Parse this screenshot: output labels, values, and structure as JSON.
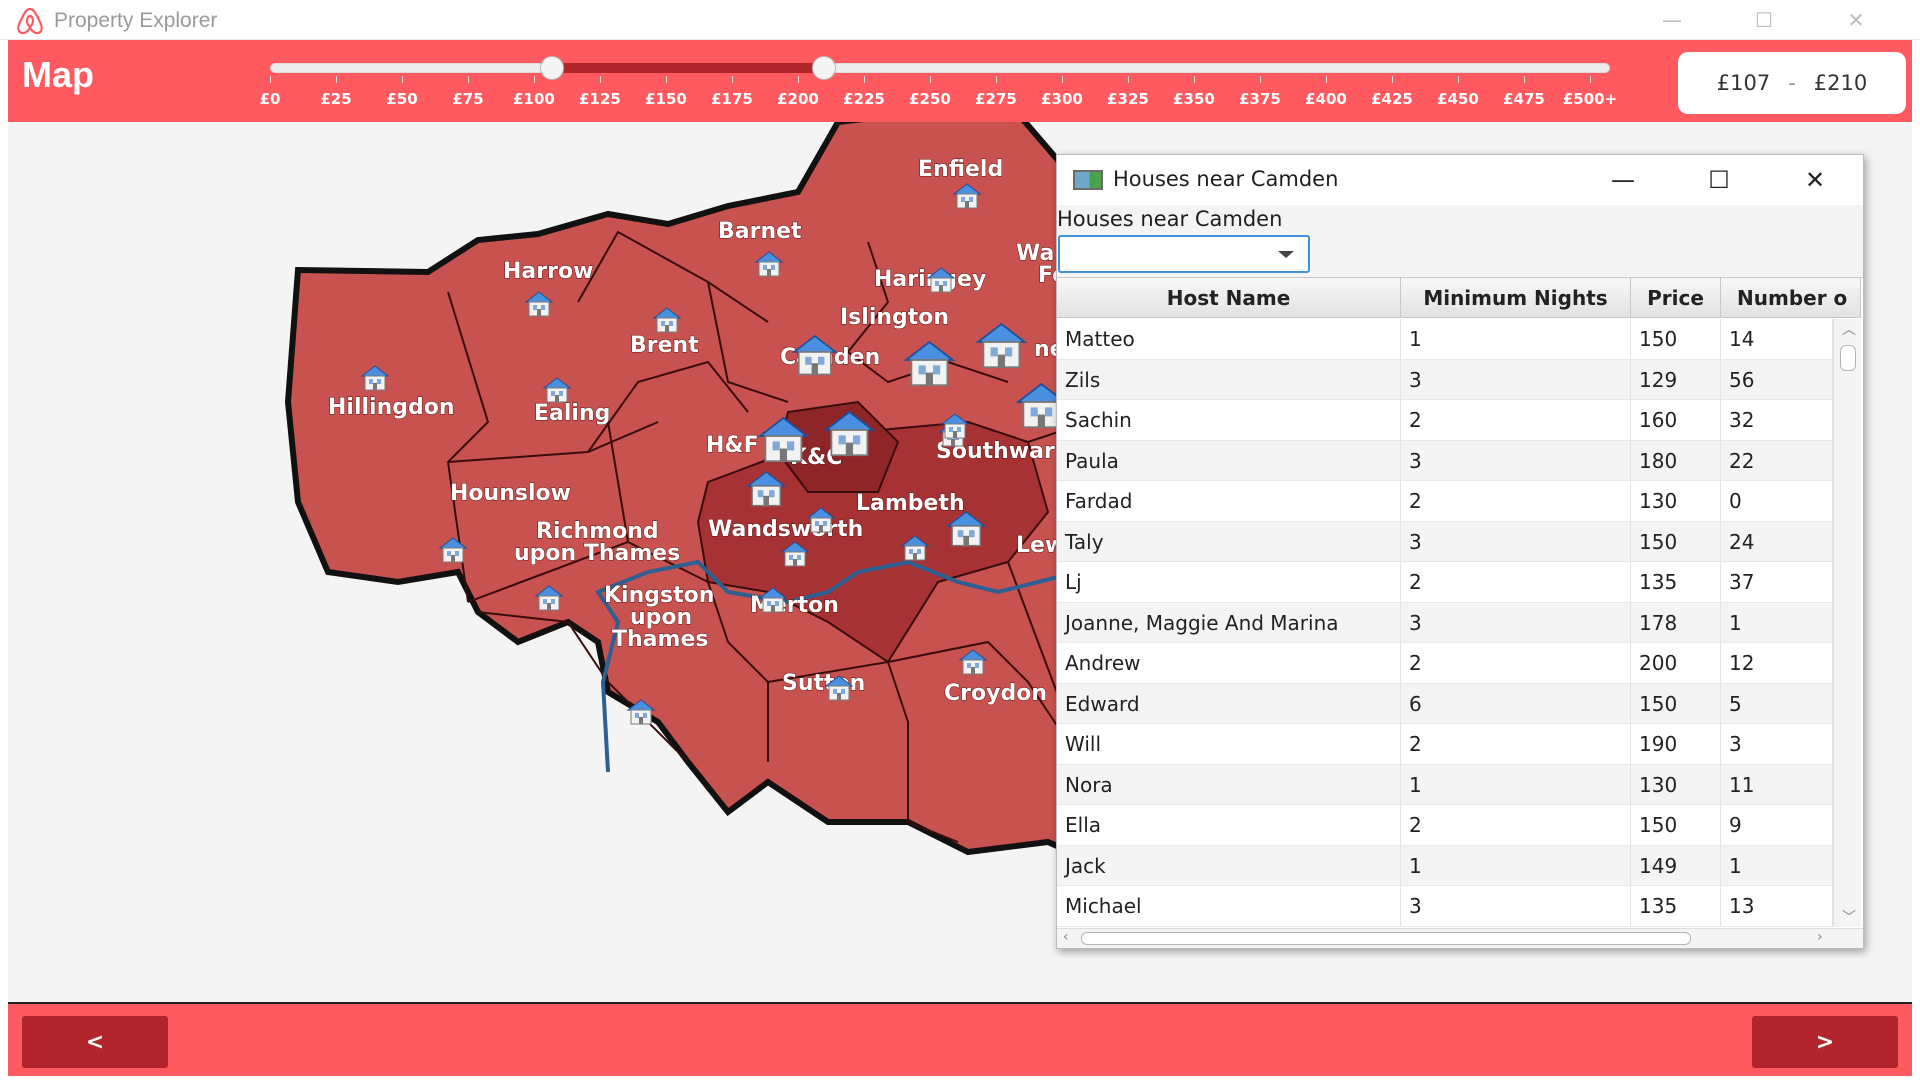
{
  "app": {
    "title": "Property Explorer",
    "window_controls": {
      "minimize": "—",
      "maximize": "☐",
      "close": "✕"
    }
  },
  "header": {
    "title": "Map",
    "slider": {
      "ticks": [
        "£0",
        "£25",
        "£50",
        "£75",
        "£100",
        "£125",
        "£150",
        "£175",
        "£200",
        "£225",
        "£250",
        "£275",
        "£300",
        "£325",
        "£350",
        "£375",
        "£400",
        "£425",
        "£450",
        "£475",
        "£500+"
      ],
      "min": 0,
      "max": 500,
      "low_value": 107,
      "high_value": 210
    },
    "price_min": "£107",
    "price_separator": "-",
    "price_max": "£210"
  },
  "map": {
    "boroughs": [
      "Enfield",
      "Barnet",
      "Harrow",
      "Haringey",
      "Islington",
      "Brent",
      "Camden",
      "Hillingdon",
      "Ealing",
      "H&F",
      "K&C",
      "Southwark",
      "Hounslow",
      "Lambeth",
      "Richmond",
      "upon Thames",
      "Wandsworth",
      "Kingston",
      "upon",
      "Thames",
      "Merton",
      "Sutton",
      "Croydon",
      "Lew",
      "Wa",
      "Fo",
      "ne"
    ],
    "house_icon": "house-icon"
  },
  "popup": {
    "title": "Houses near Camden",
    "label": "Houses near Camden",
    "combo_value": "",
    "window_controls": {
      "minimize": "—",
      "maximize": "☐",
      "close": "✕"
    },
    "table": {
      "columns": [
        "Host Name",
        "Minimum Nights",
        "Price",
        "Number o"
      ],
      "rows": [
        [
          "Matteo",
          "1",
          "150",
          "14"
        ],
        [
          "Zils",
          "3",
          "129",
          "56"
        ],
        [
          "Sachin",
          "2",
          "160",
          "32"
        ],
        [
          "Paula",
          "3",
          "180",
          "22"
        ],
        [
          "Fardad",
          "2",
          "130",
          "0"
        ],
        [
          "Taly",
          "3",
          "150",
          "24"
        ],
        [
          "Lj",
          "2",
          "135",
          "37"
        ],
        [
          "Joanne, Maggie And Marina",
          "3",
          "178",
          "1"
        ],
        [
          "Andrew",
          "2",
          "200",
          "12"
        ],
        [
          "Edward",
          "6",
          "150",
          "5"
        ],
        [
          "Will",
          "2",
          "190",
          "3"
        ],
        [
          "Nora",
          "1",
          "130",
          "11"
        ],
        [
          "Ella",
          "2",
          "150",
          "9"
        ],
        [
          "Jack",
          "1",
          "149",
          "1"
        ],
        [
          "Michael",
          "3",
          "135",
          "13"
        ]
      ]
    }
  },
  "footer": {
    "prev_label": "<",
    "next_label": ">"
  },
  "colors": {
    "accent": "#fe5a5f",
    "button": "#b2252d",
    "borough": "#c8524f",
    "borough_highlight": "#a63234",
    "borough_selected": "#8e2628",
    "river": "#2e5f92"
  }
}
